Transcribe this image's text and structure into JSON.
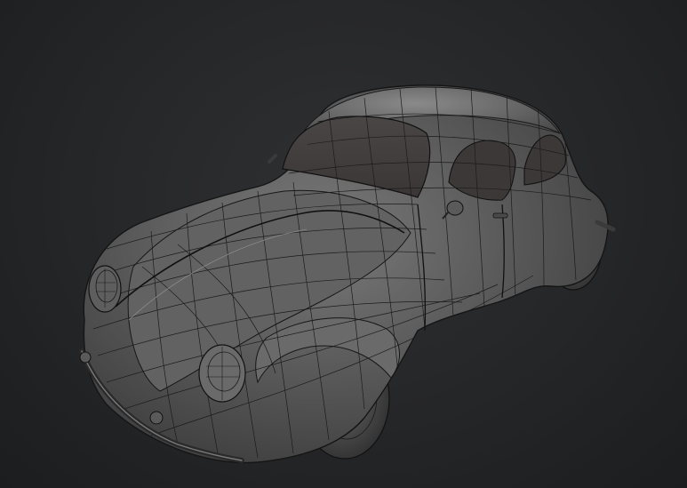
{
  "scene": {
    "subject_icon": "wireframe-car-icon",
    "colors": {
      "background": "#252628",
      "body_surface": "#5a5a5a",
      "wire": "#1a1a1a",
      "highlight": "#9a9a9a",
      "tire": "#2a2a2a"
    }
  }
}
